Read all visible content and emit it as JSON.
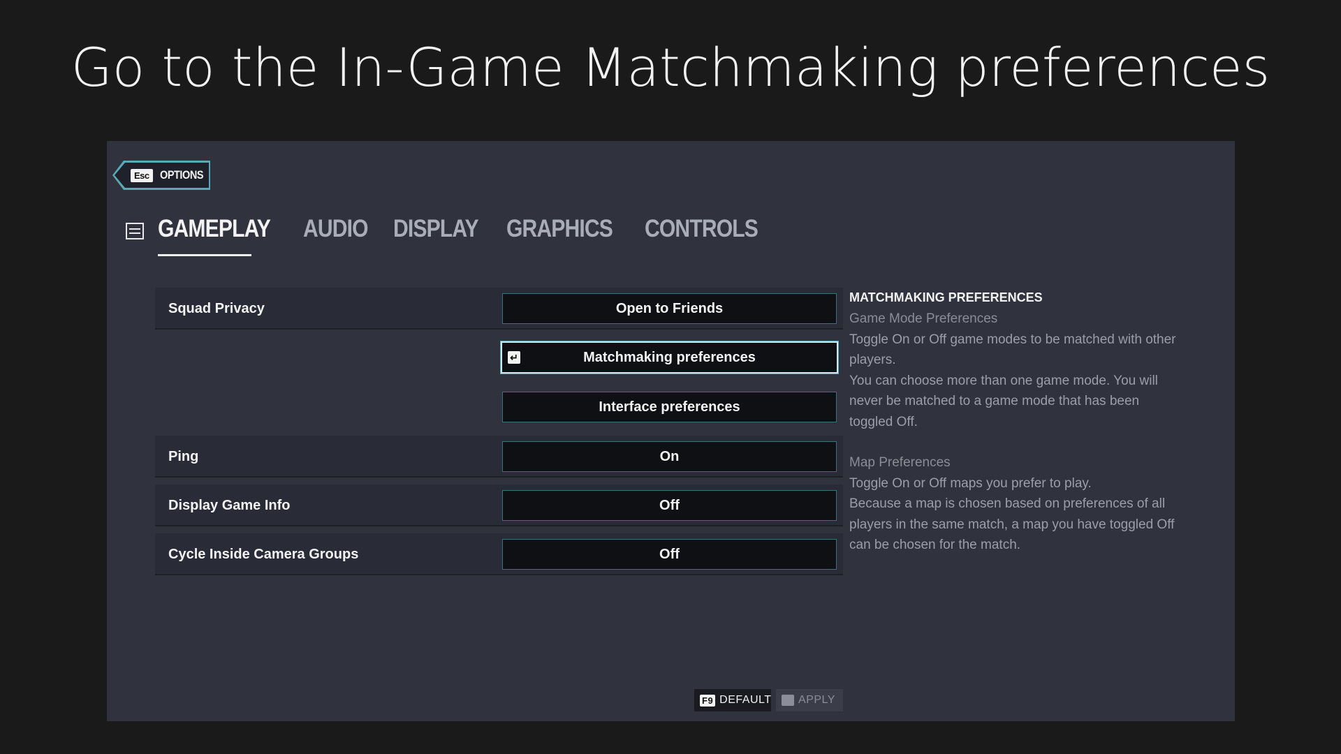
{
  "heading": "Go to the In-Game Matchmaking preferences",
  "back": {
    "key": "Esc",
    "label": "OPTIONS"
  },
  "tabs": [
    {
      "label": "GAMEPLAY",
      "active": true
    },
    {
      "label": "AUDIO",
      "active": false
    },
    {
      "label": "DISPLAY",
      "active": false
    },
    {
      "label": "GRAPHICS",
      "active": false
    },
    {
      "label": "CONTROLS",
      "active": false
    }
  ],
  "settings": {
    "squad_privacy": {
      "label": "Squad Privacy",
      "value": "Open to Friends"
    },
    "matchmaking_preferences": {
      "value": "Matchmaking preferences"
    },
    "interface_preferences": {
      "value": "Interface preferences"
    },
    "ping": {
      "label": "Ping",
      "value": "On"
    },
    "display_game_info": {
      "label": "Display Game Info",
      "value": "Off"
    },
    "cycle_camera_groups": {
      "label": "Cycle Inside Camera Groups",
      "value": "Off"
    }
  },
  "description": {
    "title": "MATCHMAKING PREFERENCES",
    "section1_title": "Game Mode Preferences",
    "section1_line1": "Toggle On or Off game modes to be matched with other players.",
    "section1_line2": "You can choose more than one game mode. You will never be matched to a game mode that has been toggled Off.",
    "section2_title": "Map Preferences",
    "section2_line1": "Toggle On or Off maps you prefer to play.",
    "section2_line2": "Because a map is chosen based on preferences of all players in the same match, a map you have toggled Off can be chosen for the match."
  },
  "footer": {
    "default_key": "F9",
    "default_label": "DEFAULT",
    "apply_label": "APPLY"
  },
  "colors": {
    "background": "#1a1a1b",
    "panel": "#30333e",
    "accent": "#5aa8b8"
  }
}
